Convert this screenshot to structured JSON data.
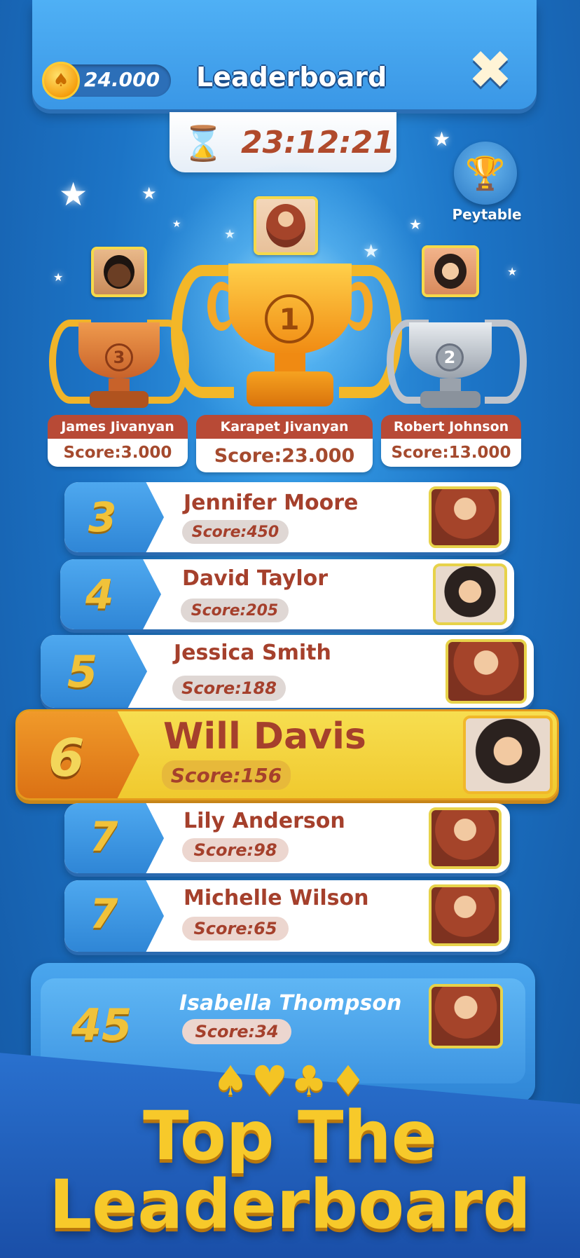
{
  "header": {
    "coins": "24.000",
    "title": "Leaderboard",
    "close_icon": "close-icon"
  },
  "timer": {
    "value": "23:12:21",
    "icon": "hourglass-icon"
  },
  "peytable": {
    "label": "Peytable",
    "icon": "trophy-icon"
  },
  "podium": [
    {
      "place": "3",
      "name": "James Jivanyan",
      "score": "Score:3.000"
    },
    {
      "place": "1",
      "name": "Karapet Jivanyan",
      "score": "Score:23.000"
    },
    {
      "place": "2",
      "name": "Robert Johnson",
      "score": "Score:13.000"
    }
  ],
  "rows": [
    {
      "rank": "3",
      "name": "Jennifer Moore",
      "score": "Score:450"
    },
    {
      "rank": "4",
      "name": "David Taylor",
      "score": "Score:205"
    },
    {
      "rank": "5",
      "name": "Jessica Smith",
      "score": "Score:188"
    },
    {
      "rank": "6",
      "name": "Will Davis",
      "score": "Score:156"
    },
    {
      "rank": "7",
      "name": "Lily Anderson",
      "score": "Score:98"
    },
    {
      "rank": "7",
      "name": "Michelle Wilson",
      "score": "Score:65"
    }
  ],
  "self_row": {
    "rank": "45",
    "name": "Isabella Thompson",
    "score": "Score:34"
  },
  "banner": {
    "suits": "♠♥♣♦",
    "line1": "Top The",
    "line2": "Leaderboard"
  },
  "colors": {
    "accent_gold": "#f7c92a",
    "name_red": "#a5402c",
    "highlight_orange": "#db7114"
  }
}
